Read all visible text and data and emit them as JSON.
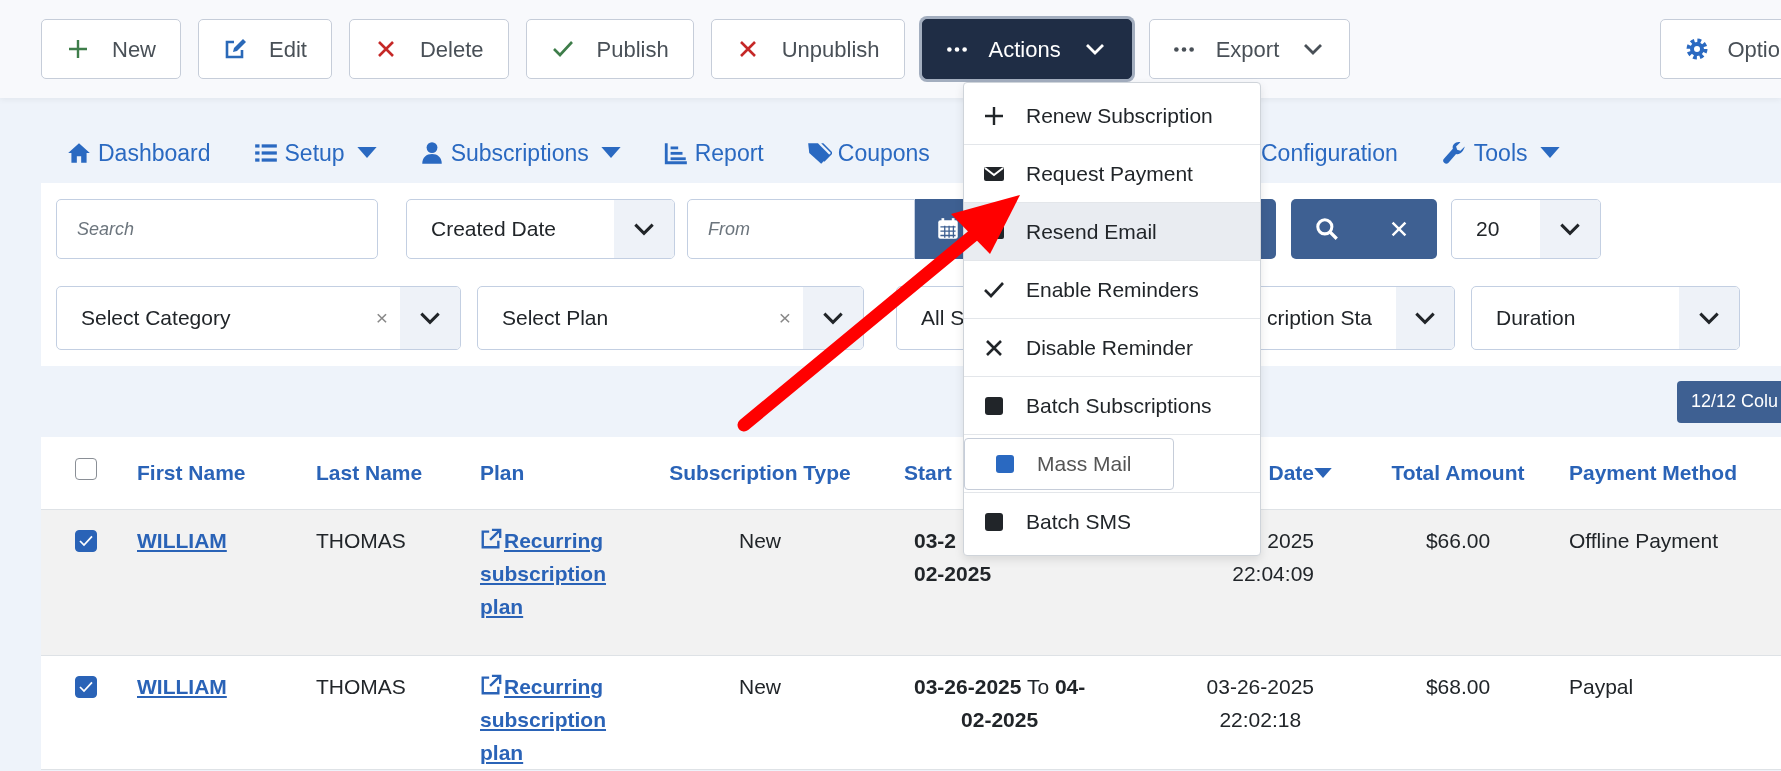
{
  "toolbar": {
    "buttons": [
      {
        "label": "New",
        "kind": "plus",
        "dropdown": false,
        "active": false
      },
      {
        "label": "Edit",
        "kind": "edit",
        "dropdown": false,
        "active": false
      },
      {
        "label": "Delete",
        "kind": "times",
        "dropdown": false,
        "active": false
      },
      {
        "label": "Publish",
        "kind": "check",
        "dropdown": false,
        "active": false
      },
      {
        "label": "Unpublish",
        "kind": "times",
        "dropdown": false,
        "active": false
      },
      {
        "label": "Actions",
        "kind": "dots",
        "dropdown": true,
        "active": true
      },
      {
        "label": "Export",
        "kind": "dots",
        "dropdown": true,
        "active": false
      },
      {
        "label": "Optio",
        "kind": "gear",
        "dropdown": false,
        "active": false
      }
    ]
  },
  "actions_menu": {
    "items": [
      {
        "label": "Renew Subscription",
        "kind": "plus",
        "highlighted": false,
        "focused": false
      },
      {
        "label": "Request Payment",
        "kind": "envelope",
        "highlighted": false,
        "focused": false
      },
      {
        "label": "Resend Email",
        "kind": "envelope",
        "highlighted": true,
        "focused": false
      },
      {
        "label": "Enable Reminders",
        "kind": "check",
        "highlighted": false,
        "focused": false
      },
      {
        "label": "Disable Reminder",
        "kind": "times",
        "highlighted": false,
        "focused": false
      },
      {
        "label": "Batch Subscriptions",
        "kind": "square",
        "highlighted": false,
        "focused": false
      },
      {
        "label": "Mass Mail",
        "kind": "square",
        "highlighted": false,
        "focused": true
      },
      {
        "label": "Batch SMS",
        "kind": "square",
        "highlighted": false,
        "focused": false
      }
    ]
  },
  "nav": {
    "items": [
      {
        "label": "Dashboard",
        "kind": "home",
        "dropdown": false
      },
      {
        "label": "Setup",
        "kind": "list",
        "dropdown": true
      },
      {
        "label": "Subscriptions",
        "kind": "user",
        "dropdown": true
      },
      {
        "label": "Report",
        "kind": "chart",
        "dropdown": false
      },
      {
        "label": "Coupons",
        "kind": "tags",
        "dropdown": false
      },
      {
        "label": "Configuration",
        "kind": "plain",
        "dropdown": false
      },
      {
        "label": "Tools",
        "kind": "wrench",
        "dropdown": true
      }
    ]
  },
  "filters": {
    "row_1": [
      {
        "kind": "text",
        "placeholder": "Search"
      },
      {
        "kind": "select",
        "value": "Created Date"
      },
      {
        "kind": "date",
        "placeholder": "From"
      },
      {
        "kind": "search-clear"
      },
      {
        "kind": "select",
        "value": "20"
      }
    ],
    "row_2": [
      {
        "kind": "select",
        "value": "Select Category",
        "clear_label": "×"
      },
      {
        "kind": "select",
        "value": "Select Plan",
        "clear_label": "×"
      },
      {
        "kind": "covered-select",
        "value": "All S"
      },
      {
        "kind": "select",
        "value": "cription Sta"
      },
      {
        "kind": "select",
        "value": "Duration"
      }
    ]
  },
  "columns_button": "12/12 Colu",
  "table": {
    "select_all": {
      "checked": false
    },
    "columns": [
      {
        "label": "First Name",
        "sorted": false
      },
      {
        "label": "Last Name",
        "sorted": false
      },
      {
        "label": "Plan",
        "sorted": false
      },
      {
        "label": "Subscription Type",
        "sorted": false
      },
      {
        "label": "Start",
        "sorted": false
      },
      {
        "label": "Date",
        "sorted": true
      },
      {
        "label": "Total Amount",
        "sorted": false
      },
      {
        "label": "Payment Method",
        "sorted": false
      }
    ],
    "rows": [
      {
        "checked": true,
        "first_name": "WILLIAM",
        "last_name": "THOMAS",
        "plan": "Recurring subscription plan",
        "type": "New",
        "start_lines": [
          [
            {
              "text": "03-2",
              "bold": true
            }
          ],
          [
            {
              "text": "02-2025",
              "bold": true
            }
          ]
        ],
        "created_lines": [
          "2025",
          "22:04:09"
        ],
        "amount": "$66.00",
        "payment": "Offline Payment"
      },
      {
        "checked": true,
        "first_name": "WILLIAM",
        "last_name": "THOMAS",
        "plan": "Recurring subscription plan",
        "type": "New",
        "start_lines": [
          [
            {
              "text": "03-26-2025",
              "bold": true
            },
            {
              "text": "To",
              "bold": false
            },
            {
              "text": "04-",
              "bold": true
            }
          ],
          [
            {
              "text": "02-2025",
              "bold": true
            }
          ]
        ],
        "created_lines": [
          "03-26-2025",
          "22:02:18"
        ],
        "amount": "$68.00",
        "payment": "Paypal"
      }
    ]
  }
}
